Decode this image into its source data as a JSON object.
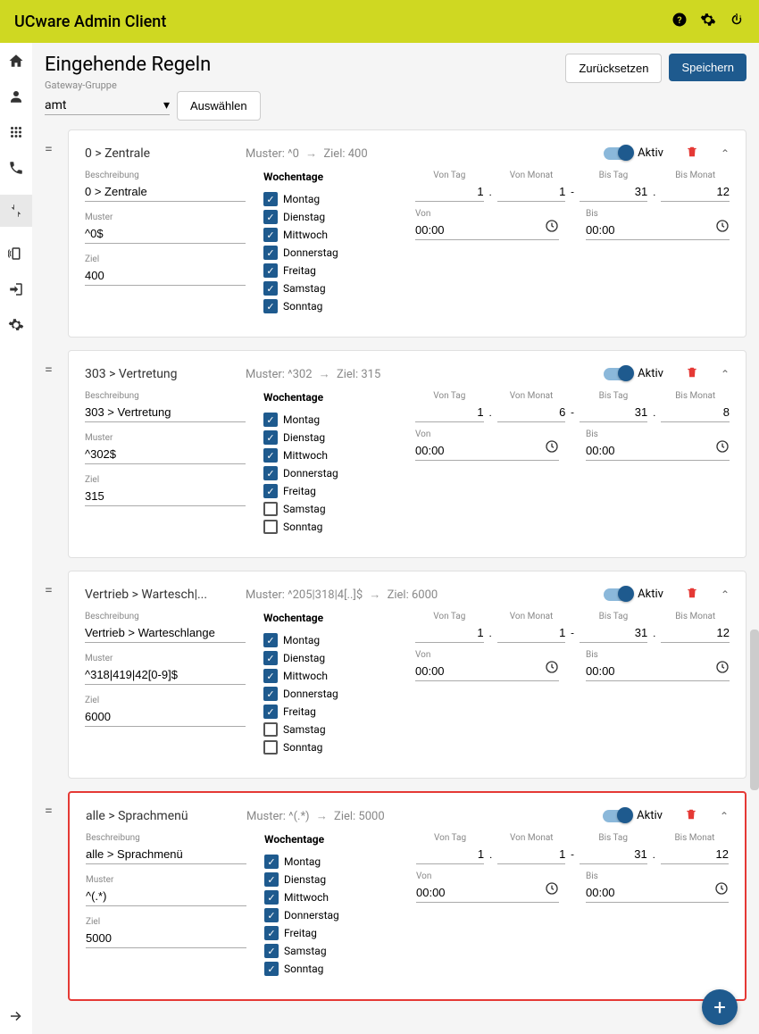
{
  "topbar": {
    "title": "UCware Admin Client"
  },
  "page": {
    "title": "Eingehende Regeln",
    "group_label": "Gateway-Gruppe",
    "group_value": "amt",
    "select_button": "Auswählen",
    "reset": "Zurücksetzen",
    "save": "Speichern"
  },
  "labels": {
    "desc": "Beschreibung",
    "pattern": "Muster",
    "target": "Ziel",
    "weekdays": "Wochentage",
    "from_day": "Von Tag",
    "from_month": "Von Monat",
    "to_day": "Bis Tag",
    "to_month": "Bis Monat",
    "from": "Von",
    "to": "Bis",
    "active": "Aktiv",
    "muster_prefix": "Muster:",
    "ziel_prefix": "Ziel:"
  },
  "weekdays": [
    "Montag",
    "Dienstag",
    "Mittwoch",
    "Donnerstag",
    "Freitag",
    "Samstag",
    "Sonntag"
  ],
  "rules": [
    {
      "title": "0 > Zentrale",
      "header_pattern": "^0",
      "header_target": "400",
      "desc": "0 > Zentrale",
      "pattern": "^0$",
      "target": "400",
      "days": [
        true,
        true,
        true,
        true,
        true,
        true,
        true
      ],
      "from_day": "1",
      "from_month": "1",
      "to_day": "31",
      "to_month": "12",
      "from_time": "00:00",
      "to_time": "00:00",
      "highlight": false
    },
    {
      "title": "303 > Vertretung",
      "header_pattern": "^302",
      "header_target": "315",
      "desc": "303 > Vertretung",
      "pattern": "^302$",
      "target": "315",
      "days": [
        true,
        true,
        true,
        true,
        true,
        false,
        false
      ],
      "from_day": "1",
      "from_month": "6",
      "to_day": "31",
      "to_month": "8",
      "from_time": "00:00",
      "to_time": "00:00",
      "highlight": false
    },
    {
      "title": "Vertrieb > Wartesch|...",
      "header_pattern": "^205|318|4[..]$",
      "header_target": "6000",
      "desc": "Vertrieb > Warteschlange",
      "pattern": "^318|419|42[0-9]$",
      "target": "6000",
      "days": [
        true,
        true,
        true,
        true,
        true,
        false,
        false
      ],
      "from_day": "1",
      "from_month": "1",
      "to_day": "31",
      "to_month": "12",
      "from_time": "00:00",
      "to_time": "00:00",
      "highlight": false
    },
    {
      "title": "alle > Sprachmenü",
      "header_pattern": "^(.*)",
      "header_target": "5000",
      "desc": "alle > Sprachmenü",
      "pattern": "^(.*)",
      "target": "5000",
      "days": [
        true,
        true,
        true,
        true,
        true,
        true,
        true
      ],
      "from_day": "1",
      "from_month": "1",
      "to_day": "31",
      "to_month": "12",
      "from_time": "00:00",
      "to_time": "00:00",
      "highlight": true
    }
  ]
}
